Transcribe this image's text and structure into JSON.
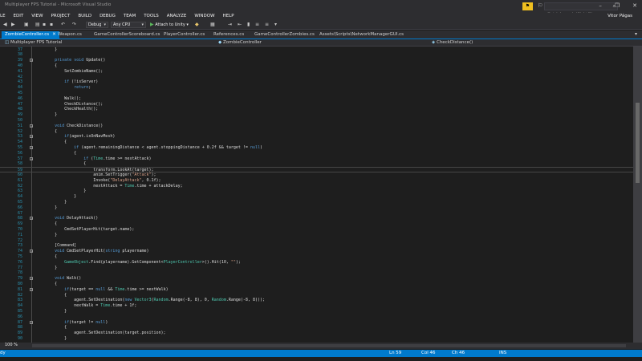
{
  "window": {
    "title": "Multiplayer FPS Tutorial - Microsoft Visual Studio",
    "controls": [
      "–",
      "❐",
      "✕"
    ]
  },
  "quick_launch": {
    "placeholder": "Quick Launch (Ctrl+Q)"
  },
  "menu": {
    "items": [
      "LE",
      "EDIT",
      "VIEW",
      "PROJECT",
      "BUILD",
      "DEBUG",
      "TEAM",
      "TOOLS",
      "ANALYZE",
      "WINDOW",
      "HELP"
    ],
    "user": "Vitor Págas"
  },
  "toolbar": {
    "config": "Debug",
    "platform": "Any CPU",
    "attach": "Attach to Unity"
  },
  "tabs": [
    {
      "label": "ZombieController.cs",
      "active": true
    },
    {
      "label": "Weapon.cs"
    },
    {
      "label": "GameControllerScoreboard.cs"
    },
    {
      "label": "PlayerController.cs"
    },
    {
      "label": "References.cs"
    },
    {
      "label": "GameControllerZombies.cs"
    },
    {
      "label": "Assets\\Scripts\\NetworkManagerGUI.cs"
    }
  ],
  "navbar": {
    "project": "Multiplayer FPS Tutorial",
    "class": "ZombieController",
    "member": "CheckDistance()"
  },
  "code": [
    {
      "n": 37,
      "t": "        }"
    },
    {
      "n": 38,
      "t": ""
    },
    {
      "n": 39,
      "t": "        private void Update()",
      "fold": true
    },
    {
      "n": 40,
      "t": "        {"
    },
    {
      "n": 41,
      "t": "            SetZombieName();"
    },
    {
      "n": 42,
      "t": ""
    },
    {
      "n": 43,
      "t": "            if (!isServer)"
    },
    {
      "n": 44,
      "t": "                return;"
    },
    {
      "n": 45,
      "t": ""
    },
    {
      "n": 46,
      "t": "            Walk();"
    },
    {
      "n": 47,
      "t": "            CheckDistance();"
    },
    {
      "n": 48,
      "t": "            CheckHealth();"
    },
    {
      "n": 49,
      "t": "        }"
    },
    {
      "n": 50,
      "t": ""
    },
    {
      "n": 51,
      "t": "        void CheckDistance()",
      "fold": true
    },
    {
      "n": 52,
      "t": "        {"
    },
    {
      "n": 53,
      "t": "            if(agent.isOnNavMesh)",
      "fold": true
    },
    {
      "n": 54,
      "t": "            {"
    },
    {
      "n": 55,
      "t": "                if (agent.remainingDistance < agent.stoppingDistance + 0.2f && target != null)",
      "fold": true
    },
    {
      "n": 56,
      "t": "                {"
    },
    {
      "n": 57,
      "t": "                    if (Time.time >= nextAttack)",
      "fold": true
    },
    {
      "n": 58,
      "t": "                    {"
    },
    {
      "n": 59,
      "t": "                        transform.LookAt(target);",
      "current": true
    },
    {
      "n": 60,
      "t": "                        anim.SetTrigger(\"Attack\");"
    },
    {
      "n": 61,
      "t": "                        Invoke(\"DelayAttack\", 0.1f);"
    },
    {
      "n": 62,
      "t": "                        nextAttack = Time.time + attackDelay;"
    },
    {
      "n": 63,
      "t": "                    }"
    },
    {
      "n": 64,
      "t": "                }"
    },
    {
      "n": 65,
      "t": "            }"
    },
    {
      "n": 66,
      "t": "        }"
    },
    {
      "n": 67,
      "t": ""
    },
    {
      "n": 68,
      "t": "        void DelayAttack()",
      "fold": true
    },
    {
      "n": 69,
      "t": "        {"
    },
    {
      "n": 70,
      "t": "            CmdSetPlayerHit(target.name);"
    },
    {
      "n": 71,
      "t": "        }"
    },
    {
      "n": 72,
      "t": ""
    },
    {
      "n": 73,
      "t": "        [Command]"
    },
    {
      "n": 74,
      "t": "        void CmdSetPlayerHit(string playername)",
      "fold": true
    },
    {
      "n": 75,
      "t": "        {"
    },
    {
      "n": 76,
      "t": "            GameObject.Find(playername).GetComponent<PlayerController>().Hit(10, \"\");"
    },
    {
      "n": 77,
      "t": "        }"
    },
    {
      "n": 78,
      "t": ""
    },
    {
      "n": 79,
      "t": "        void Walk()",
      "fold": true
    },
    {
      "n": 80,
      "t": "        {"
    },
    {
      "n": 81,
      "t": "            if(target == null && Time.time >= nextWalk)",
      "fold": true
    },
    {
      "n": 82,
      "t": "            {"
    },
    {
      "n": 83,
      "t": "                agent.SetDestination(new Vector3(Random.Range(-8, 8), 0, Random.Range(-8, 8)));"
    },
    {
      "n": 84,
      "t": "                nextWalk = Time.time + 1f;"
    },
    {
      "n": 85,
      "t": "            }"
    },
    {
      "n": 86,
      "t": ""
    },
    {
      "n": 87,
      "t": "            if(target != null)",
      "fold": true
    },
    {
      "n": 88,
      "t": "            {"
    },
    {
      "n": 89,
      "t": "                agent.SetDestination(target.position);"
    },
    {
      "n": 90,
      "t": "            }"
    }
  ],
  "zoom": "100 %",
  "status": {
    "left": "dy",
    "ln": "Ln 59",
    "col": "Col 46",
    "ch": "Ch 46",
    "mode": "INS"
  },
  "colors": {
    "accent": "#007acc",
    "keyword": "#569cd6",
    "string": "#d69d85",
    "type": "#4ec9b0",
    "linenum": "#2b91af"
  }
}
